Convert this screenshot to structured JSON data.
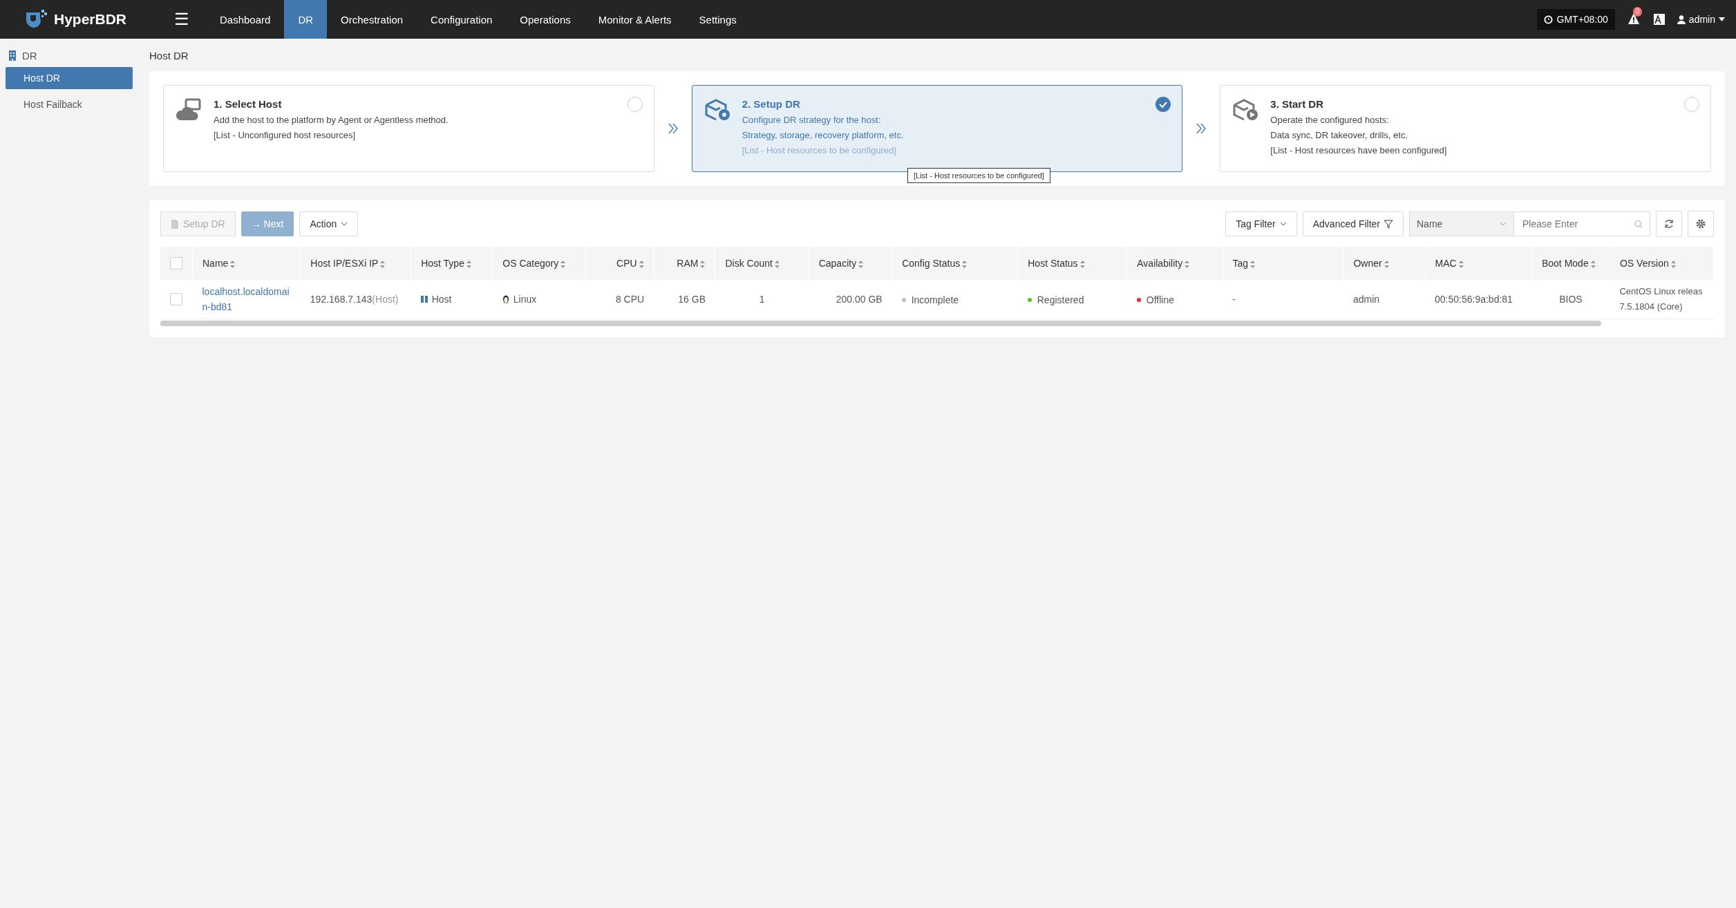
{
  "topbar": {
    "brand": "HyperBDR",
    "menu_icon": "☰",
    "nav": [
      {
        "label": "Dashboard",
        "selected": false
      },
      {
        "label": "DR",
        "selected": true
      },
      {
        "label": "Orchestration",
        "selected": false
      },
      {
        "label": "Configuration",
        "selected": false
      },
      {
        "label": "Operations",
        "selected": false
      },
      {
        "label": "Monitor & Alerts",
        "selected": false
      },
      {
        "label": "Settings",
        "selected": false
      }
    ],
    "timezone": "GMT+08:00",
    "alert_count": "0",
    "user": "admin"
  },
  "sidebar": {
    "title": "DR",
    "items": [
      {
        "label": "Host DR",
        "selected": true
      },
      {
        "label": "Host Failback",
        "selected": false
      }
    ]
  },
  "page_title": "Host DR",
  "steps": [
    {
      "kind": "select",
      "title": "1. Select Host",
      "lines": [
        "Add the host to the platform by Agent or Agentless method."
      ],
      "note": "[List - Unconfigured host resources]",
      "selected": false
    },
    {
      "kind": "setup",
      "title": "2. Setup DR",
      "lines": [
        "Configure DR strategy for the host:",
        "Strategy, storage, recovery platform, etc."
      ],
      "note": "[List - Host resources to be configured]",
      "selected": true
    },
    {
      "kind": "start",
      "title": "3. Start DR",
      "lines": [
        "Operate the configured hosts:",
        "Data sync, DR takeover, drills, etc."
      ],
      "note": "[List - Host resources have been configured]",
      "selected": false
    }
  ],
  "tooltip": "[List - Host resources to be configured]",
  "toolbar": {
    "setup_button": "Setup DR",
    "next_button": "→ Next",
    "action_button": "Action",
    "tag_filter": "Tag Filter",
    "advanced_filter": "Advanced Filter",
    "search_scope": "Name",
    "search_placeholder": "Please Enter"
  },
  "table": {
    "all_checked": false,
    "columns": [
      {
        "label": "Name"
      },
      {
        "label": "Host IP/ESXi IP"
      },
      {
        "label": "Host Type"
      },
      {
        "label": "OS Category"
      },
      {
        "label": "CPU"
      },
      {
        "label": "RAM"
      },
      {
        "label": "Disk Count"
      },
      {
        "label": "Capacity"
      },
      {
        "label": "Config Status"
      },
      {
        "label": "Host Status"
      },
      {
        "label": "Availability"
      },
      {
        "label": "Tag"
      },
      {
        "label": "Owner"
      },
      {
        "label": "MAC"
      },
      {
        "label": "Boot Mode"
      },
      {
        "label": "OS Version"
      }
    ],
    "rows": [
      {
        "checked": false,
        "cells": [
          {
            "kind": "link",
            "text": "localhost.localdomain-bd81"
          },
          {
            "kind": "ip",
            "text": "192.168.7.143",
            "suffix": "(Host)"
          },
          {
            "kind": "hosttype",
            "text": "Host"
          },
          {
            "kind": "os",
            "text": "Linux"
          },
          {
            "kind": "text",
            "text": "8 CPU"
          },
          {
            "kind": "text",
            "text": "16 GB"
          },
          {
            "kind": "text",
            "text": "1"
          },
          {
            "kind": "text",
            "text": "200.00 GB"
          },
          {
            "kind": "status",
            "text": "Incomplete",
            "color": "#bfbfbf"
          },
          {
            "kind": "status",
            "text": "Registered",
            "color": "#52c41a"
          },
          {
            "kind": "status",
            "text": "Offline",
            "color": "#f5222d"
          },
          {
            "kind": "text",
            "text": "-"
          },
          {
            "kind": "text",
            "text": "admin"
          },
          {
            "kind": "text",
            "text": "00:50:56:9a:bd:81"
          },
          {
            "kind": "text",
            "text": "BIOS"
          },
          {
            "kind": "lines",
            "lines": [
              "CentOS Linux releas",
              "7.5.1804 (Core)"
            ]
          }
        ]
      }
    ]
  }
}
